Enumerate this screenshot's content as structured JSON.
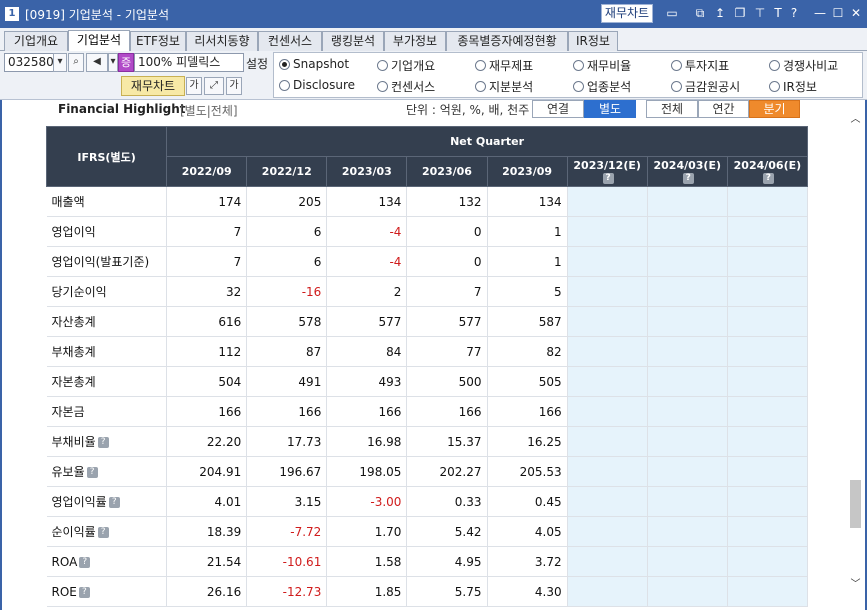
{
  "window": {
    "number": "1",
    "title": "[0919] 기업분석 - 기업분석",
    "chart_button": "재무차트"
  },
  "tabs": [
    {
      "label": "기업개요",
      "active": false
    },
    {
      "label": "기업분석",
      "active": true
    },
    {
      "label": "ETF정보",
      "active": false
    },
    {
      "label": "리서치동향",
      "active": false
    },
    {
      "label": "컨센서스",
      "active": false
    },
    {
      "label": "랭킹분석",
      "active": false
    },
    {
      "label": "부가정보",
      "active": false
    },
    {
      "label": "종목별증자예정현황",
      "active": false
    },
    {
      "label": "IR정보",
      "active": false
    }
  ],
  "toolbar": {
    "stock_code": "032580",
    "market_badge": "증",
    "percent": "100%",
    "stock_name": "피델릭스",
    "settings_label": "설정",
    "finance_chart_label": "재무차트",
    "font_label": "가",
    "font_label2": "가"
  },
  "radios": [
    {
      "label": "Snapshot",
      "checked": true
    },
    {
      "label": "기업개요",
      "checked": false
    },
    {
      "label": "재무제표",
      "checked": false
    },
    {
      "label": "재무비율",
      "checked": false
    },
    {
      "label": "투자지표",
      "checked": false
    },
    {
      "label": "경쟁사비교",
      "checked": false
    },
    {
      "label": "Disclosure",
      "checked": false
    },
    {
      "label": "컨센서스",
      "checked": false
    },
    {
      "label": "지분분석",
      "checked": false
    },
    {
      "label": "업종분석",
      "checked": false
    },
    {
      "label": "금감원공시",
      "checked": false
    },
    {
      "label": "IR정보",
      "checked": false
    }
  ],
  "highlight": {
    "title": "Financial Highlight",
    "subtitle": "[별도|전체]",
    "unit": "단위 : 억원, %, 배, 천주",
    "seg1": [
      "연결",
      "별도"
    ],
    "seg2": [
      "전체",
      "연간",
      "분기"
    ]
  },
  "table": {
    "corner": "IFRS(별도)",
    "group": "Net Quarter",
    "columns": [
      {
        "label": "2022/09",
        "estimate": false
      },
      {
        "label": "2022/12",
        "estimate": false
      },
      {
        "label": "2023/03",
        "estimate": false
      },
      {
        "label": "2023/06",
        "estimate": false
      },
      {
        "label": "2023/09",
        "estimate": false
      },
      {
        "label": "2023/12(E)",
        "estimate": true
      },
      {
        "label": "2024/03(E)",
        "estimate": true
      },
      {
        "label": "2024/06(E)",
        "estimate": true
      }
    ],
    "rows": [
      {
        "label": "매출액",
        "help": false,
        "values": [
          "174",
          "205",
          "134",
          "132",
          "134",
          "",
          "",
          ""
        ]
      },
      {
        "label": "영업이익",
        "help": false,
        "values": [
          "7",
          "6",
          "-4",
          "0",
          "1",
          "",
          "",
          ""
        ]
      },
      {
        "label": "영업이익(발표기준)",
        "help": false,
        "values": [
          "7",
          "6",
          "-4",
          "0",
          "1",
          "",
          "",
          ""
        ]
      },
      {
        "label": "당기순이익",
        "help": false,
        "values": [
          "32",
          "-16",
          "2",
          "7",
          "5",
          "",
          "",
          ""
        ]
      },
      {
        "label": "자산총계",
        "help": false,
        "values": [
          "616",
          "578",
          "577",
          "577",
          "587",
          "",
          "",
          ""
        ]
      },
      {
        "label": "부채총계",
        "help": false,
        "values": [
          "112",
          "87",
          "84",
          "77",
          "82",
          "",
          "",
          ""
        ]
      },
      {
        "label": "자본총계",
        "help": false,
        "values": [
          "504",
          "491",
          "493",
          "500",
          "505",
          "",
          "",
          ""
        ]
      },
      {
        "label": "자본금",
        "help": false,
        "values": [
          "166",
          "166",
          "166",
          "166",
          "166",
          "",
          "",
          ""
        ]
      },
      {
        "label": "부채비율",
        "help": true,
        "values": [
          "22.20",
          "17.73",
          "16.98",
          "15.37",
          "16.25",
          "",
          "",
          ""
        ]
      },
      {
        "label": "유보율",
        "help": true,
        "values": [
          "204.91",
          "196.67",
          "198.05",
          "202.27",
          "205.53",
          "",
          "",
          ""
        ]
      },
      {
        "label": "영업이익률",
        "help": true,
        "values": [
          "4.01",
          "3.15",
          "-3.00",
          "0.33",
          "0.45",
          "",
          "",
          ""
        ]
      },
      {
        "label": "순이익률",
        "help": true,
        "values": [
          "18.39",
          "-7.72",
          "1.70",
          "5.42",
          "4.05",
          "",
          "",
          ""
        ]
      },
      {
        "label": "ROA",
        "help": true,
        "values": [
          "21.54",
          "-10.61",
          "1.58",
          "4.95",
          "3.72",
          "",
          "",
          ""
        ]
      },
      {
        "label": "ROE",
        "help": true,
        "values": [
          "26.16",
          "-12.73",
          "1.85",
          "5.75",
          "4.30",
          "",
          "",
          ""
        ]
      }
    ]
  },
  "colors": {
    "titlebar": "#3a63a8",
    "header": "#343f4f",
    "estimate_bg": "#e6f3fb",
    "negative": "#d01c1c",
    "accent": "#2d6fcf",
    "orange": "#ef8a2c"
  }
}
